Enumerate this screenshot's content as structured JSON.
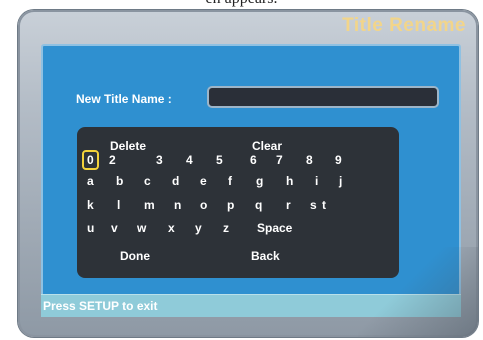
{
  "screen": {
    "title": "Title Rename",
    "caption_fragment": "en appears."
  },
  "form": {
    "label": "New Title Name :",
    "value": ""
  },
  "keyboard": {
    "delete": "Delete",
    "clear": "Clear",
    "row_digits": [
      "0",
      "2",
      "3",
      "4",
      "5",
      "6",
      "7",
      "8",
      "9"
    ],
    "row_1": [
      "a",
      "b",
      "c",
      "d",
      "e",
      "f",
      "g",
      "h",
      "i",
      "j"
    ],
    "row_2": [
      "k",
      "l",
      "m",
      "n",
      "o",
      "p",
      "q",
      "r",
      "s",
      "t"
    ],
    "row_3": [
      "u",
      "v",
      "w",
      "x",
      "y",
      "z"
    ],
    "space": "Space",
    "done": "Done",
    "back": "Back",
    "selected_key": "0"
  },
  "status": {
    "text": "Press SETUP to exit"
  },
  "colors": {
    "panel": "#2f90d0",
    "keyboard_bg": "#2d3238",
    "title": "#f2d58a",
    "selection": "#f3d23a",
    "status_bar": "#8fcbd9"
  }
}
